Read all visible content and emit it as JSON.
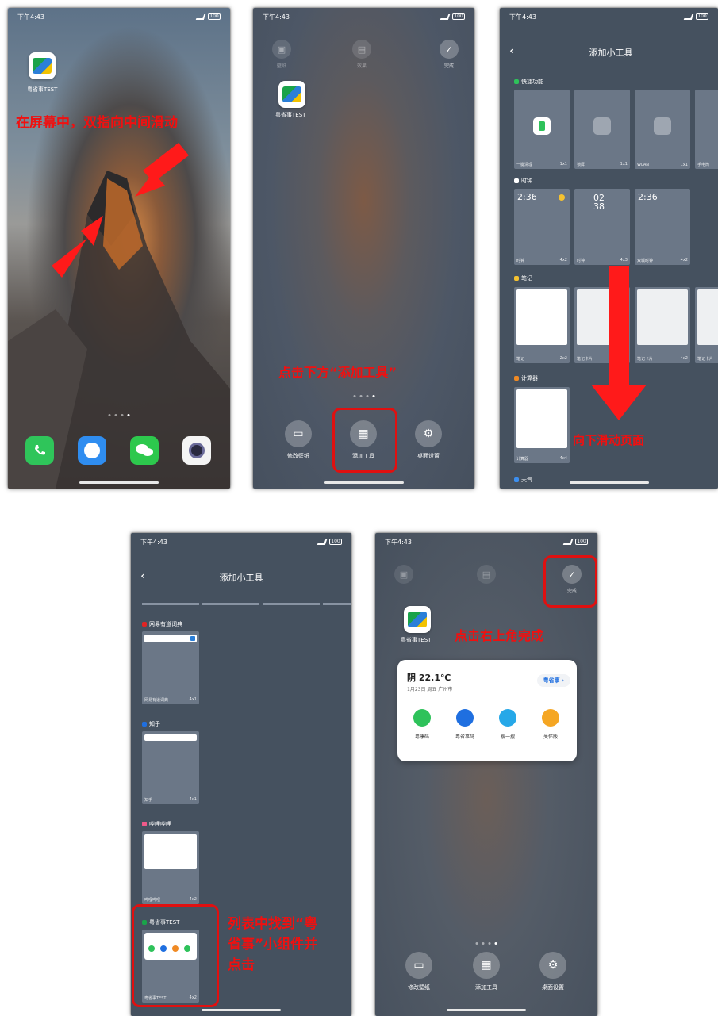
{
  "status": {
    "time": "下午4:43",
    "battery": "100"
  },
  "panel1": {
    "app_label": "粤省事TEST",
    "annotation": "在屏幕中，双指向中间滑动",
    "dock": [
      "phone",
      "message",
      "wechat",
      "camera"
    ]
  },
  "panel2": {
    "app_label": "粤省事TEST",
    "top_left_label": "壁纸",
    "top_mid_label": "效果",
    "done_label": "完成",
    "annotation": "点击下方“添加工具”",
    "buttons": {
      "wallpaper": "修改壁纸",
      "add_tool": "添加工具",
      "settings": "桌面设置"
    }
  },
  "panel3": {
    "title": "添加小工具",
    "sections": {
      "quick": "快捷功能",
      "clock": "时钟",
      "notes": "笔记",
      "calculator": "计算器",
      "weather": "天气"
    },
    "quick_tiles": [
      {
        "name": "一键清理",
        "size": "1x1"
      },
      {
        "name": "锁屏",
        "size": "1x1"
      },
      {
        "name": "WLAN",
        "size": "1x1"
      },
      {
        "name": "手电筒",
        "size": ""
      }
    ],
    "clock_tiles": [
      {
        "text": "2:36",
        "name": "时钟",
        "size": "4x2"
      },
      {
        "text": "02\n38",
        "name": "时钟",
        "size": "4x3"
      },
      {
        "text": "2:36",
        "name": "双城时钟",
        "size": "4x2"
      }
    ],
    "note_tiles": [
      {
        "name": "笔记",
        "size": "2x2"
      },
      {
        "name": "笔记卡片",
        "size": ""
      },
      {
        "name": "笔记卡片",
        "size": "4x2"
      },
      {
        "name": "笔记卡片",
        "size": ""
      }
    ],
    "calc_tile": {
      "name": "计算器",
      "size": "4x4"
    },
    "annotation": "向下滑动页面"
  },
  "panel4": {
    "title": "添加小工具",
    "items": [
      {
        "app": "网易有道词典",
        "caption": "网易有道词典",
        "size": "4x1"
      },
      {
        "app": "知乎",
        "caption": "知乎",
        "size": "4x1"
      },
      {
        "app": "哔哩哔哩",
        "caption": "哔哩哔哩",
        "size": "4x2"
      },
      {
        "app": "粤省事TEST",
        "caption": "粤省事TEST",
        "size": "4x2"
      }
    ],
    "annotation_lines": [
      "列表中找到“粤",
      "省事”小组件并",
      "点击"
    ]
  },
  "panel5": {
    "app_label": "粤省事TEST",
    "done_label": "完成",
    "annotation": "点击右上角完成",
    "widget": {
      "weather": "阴 22.1℃",
      "date": "1月23日 周五 广州市",
      "brand": "粤省事",
      "actions": [
        "粤康码",
        "粤省事码",
        "搜一搜",
        "关怀版"
      ]
    },
    "buttons": {
      "wallpaper": "修改壁纸",
      "add_tool": "添加工具",
      "settings": "桌面设置"
    }
  }
}
